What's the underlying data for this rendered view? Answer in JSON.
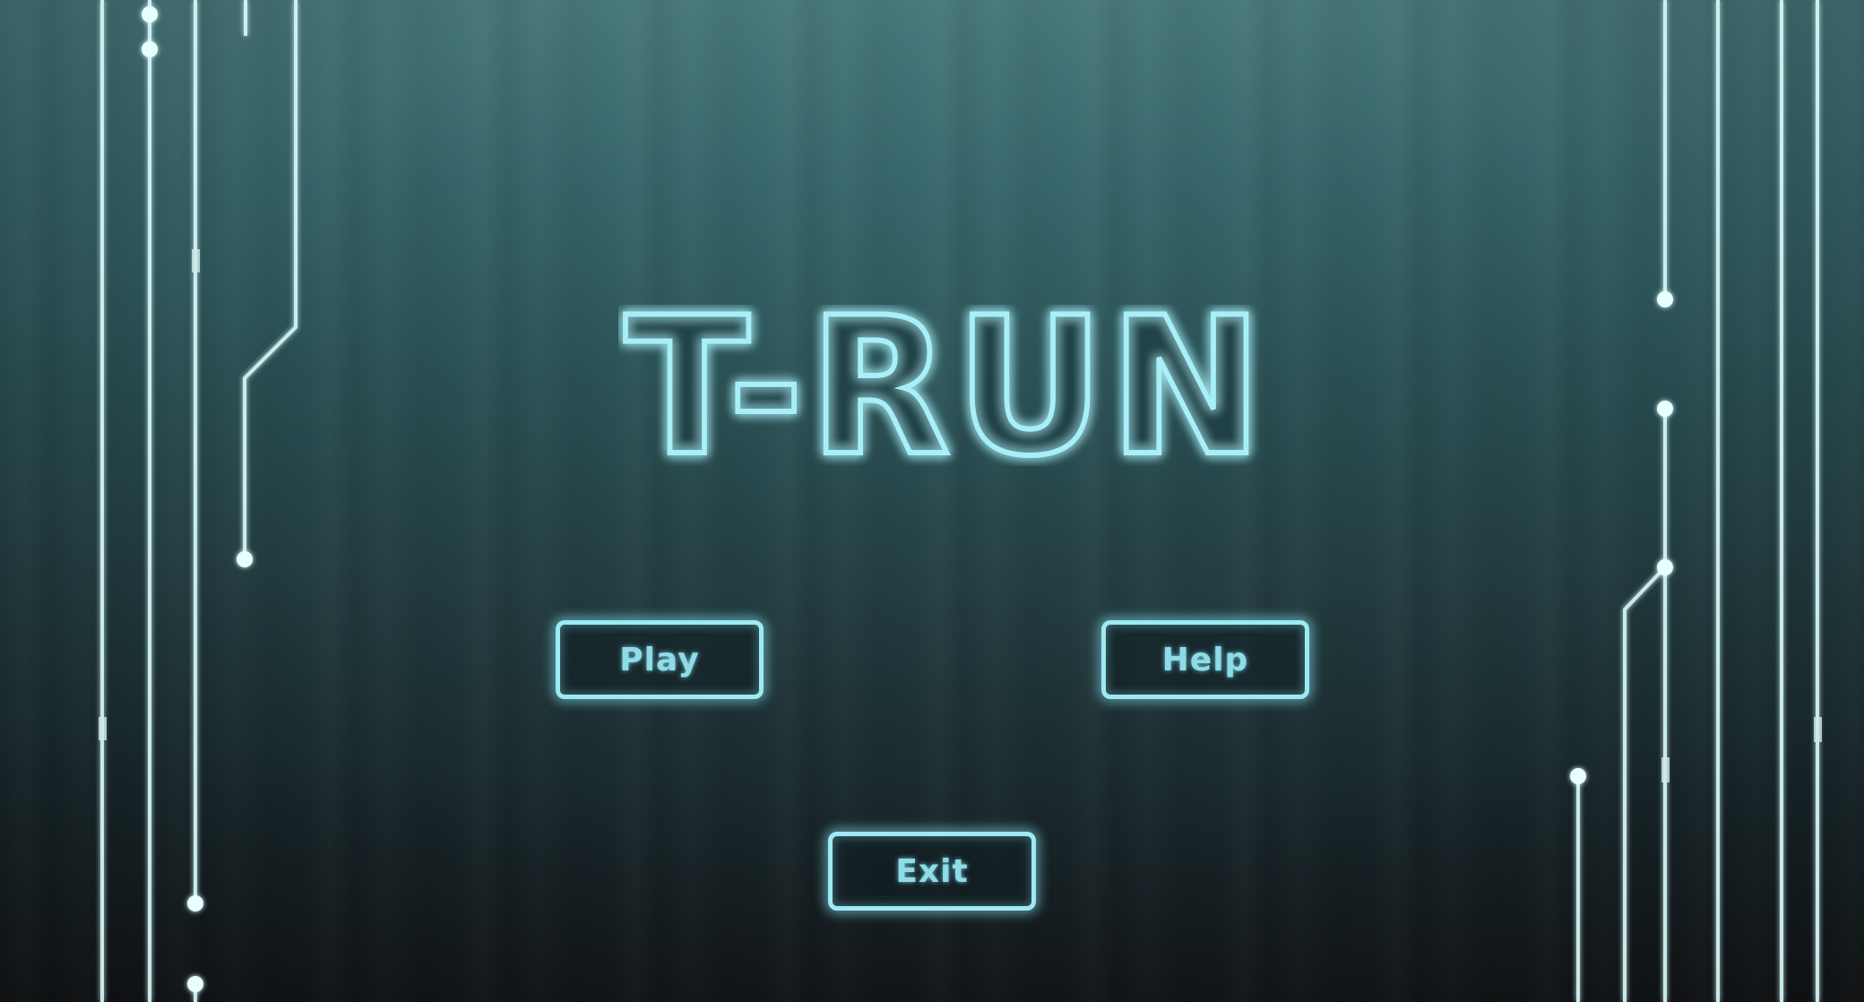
{
  "game": {
    "title": "T-RUN",
    "menu": {
      "play_label": "Play",
      "help_label": "Help",
      "exit_label": "Exit"
    }
  },
  "colors": {
    "neon_line": "#d8fbfc",
    "neon_glow": "#7fe3f2",
    "title_stroke": "#a8f0f8",
    "button_border": "#9fe9f3",
    "button_text": "#8fdbe8",
    "background_top": "#4f8488",
    "background_bottom": "#15191c"
  }
}
